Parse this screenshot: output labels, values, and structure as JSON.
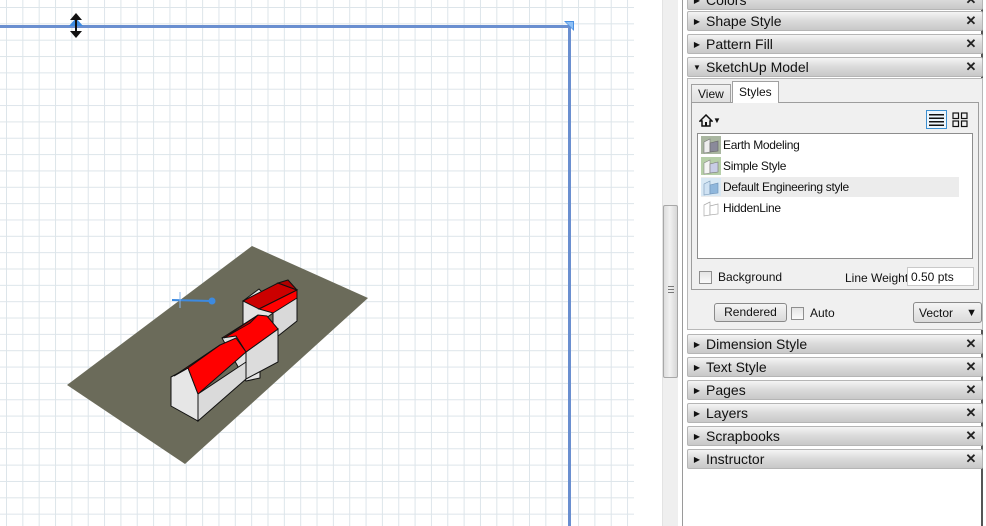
{
  "canvas": {
    "grid": true,
    "page_border_color": "#6a8fd0",
    "model": {
      "ground_color": "#6b6b5a",
      "roof_color": "#ff0000",
      "wall_color": "#e6e6e6"
    }
  },
  "tray": {
    "panels_top": [
      {
        "label": "Colors",
        "expanded": false
      },
      {
        "label": "Shape Style",
        "expanded": false
      },
      {
        "label": "Pattern Fill",
        "expanded": false
      },
      {
        "label": "SketchUp Model",
        "expanded": true
      }
    ],
    "sketchup_model": {
      "tabs": [
        {
          "label": "View",
          "active": false
        },
        {
          "label": "Styles",
          "active": true
        }
      ],
      "home_icon": "house-icon",
      "styles": [
        {
          "name": "Earth Modeling",
          "icon": "style-cube-icon",
          "selected": false
        },
        {
          "name": "Simple Style",
          "icon": "style-cube-icon",
          "selected": false
        },
        {
          "name": "Default Engineering style",
          "icon": "style-cube-icon",
          "selected": true
        },
        {
          "name": "HiddenLine",
          "icon": "style-cube-icon",
          "selected": false
        }
      ],
      "background_label": "Background",
      "background_checked": false,
      "line_weight_label": "Line Weight",
      "line_weight_value": "0.50 pts",
      "rendered_label": "Rendered",
      "auto_label": "Auto",
      "auto_checked": false,
      "render_mode": "Vector"
    },
    "panels_bottom": [
      {
        "label": "Dimension Style",
        "expanded": false
      },
      {
        "label": "Text Style",
        "expanded": false
      },
      {
        "label": "Pages",
        "expanded": false
      },
      {
        "label": "Layers",
        "expanded": false
      },
      {
        "label": "Scrapbooks",
        "expanded": false
      },
      {
        "label": "Instructor",
        "expanded": false
      }
    ],
    "close_glyph": "✕"
  }
}
